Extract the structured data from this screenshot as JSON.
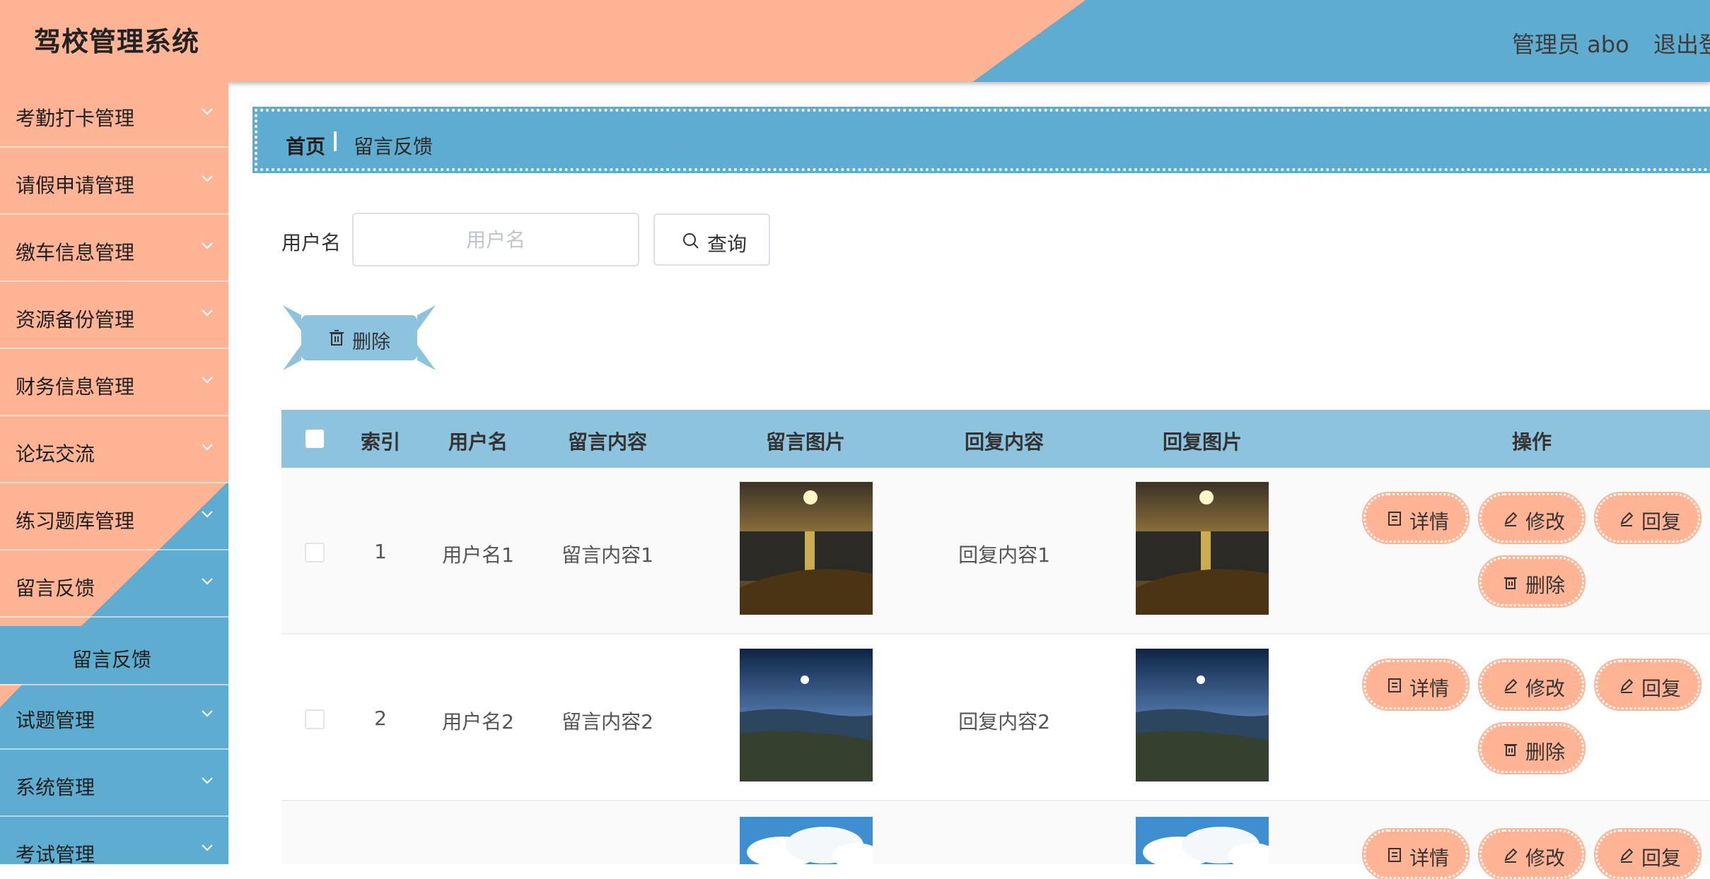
{
  "header": {
    "title": "驾校管理系统",
    "user": "管理员 abo",
    "logout": "退出登录"
  },
  "sidebar": {
    "items": [
      {
        "label": "考勤打卡管理"
      },
      {
        "label": "请假申请管理"
      },
      {
        "label": "缴车信息管理"
      },
      {
        "label": "资源备份管理"
      },
      {
        "label": "财务信息管理"
      },
      {
        "label": "论坛交流"
      },
      {
        "label": "练习题库管理"
      },
      {
        "label": "留言反馈"
      },
      {
        "label": "试题管理"
      },
      {
        "label": "系统管理"
      },
      {
        "label": "考试管理"
      }
    ],
    "open_submenu": {
      "label": "留言反馈"
    }
  },
  "breadcrumb": {
    "home": "首页",
    "current": "留言反馈"
  },
  "search": {
    "label": "用户名",
    "placeholder": "用户名",
    "value": "",
    "query_label": "查询"
  },
  "toolbar": {
    "delete_label": "删除"
  },
  "table": {
    "headers": [
      "索引",
      "用户名",
      "留言内容",
      "留言图片",
      "回复内容",
      "回复图片",
      "操作"
    ],
    "rows": [
      {
        "index": "1",
        "username": "用户名1",
        "content": "留言内容1",
        "reply": "回复内容1",
        "image": "sunset-sea"
      },
      {
        "index": "2",
        "username": "用户名2",
        "content": "留言内容2",
        "reply": "回复内容2",
        "image": "night-coast"
      },
      {
        "index": "",
        "username": "",
        "content": "",
        "reply": "",
        "image": "clouds-sky"
      }
    ],
    "actions": {
      "detail": "详情",
      "edit": "修改",
      "reply": "回复",
      "delete": "删除"
    }
  },
  "colors": {
    "salmon": "#ffb496",
    "blue": "#5eaccf",
    "light_blue": "#8ec3de"
  }
}
